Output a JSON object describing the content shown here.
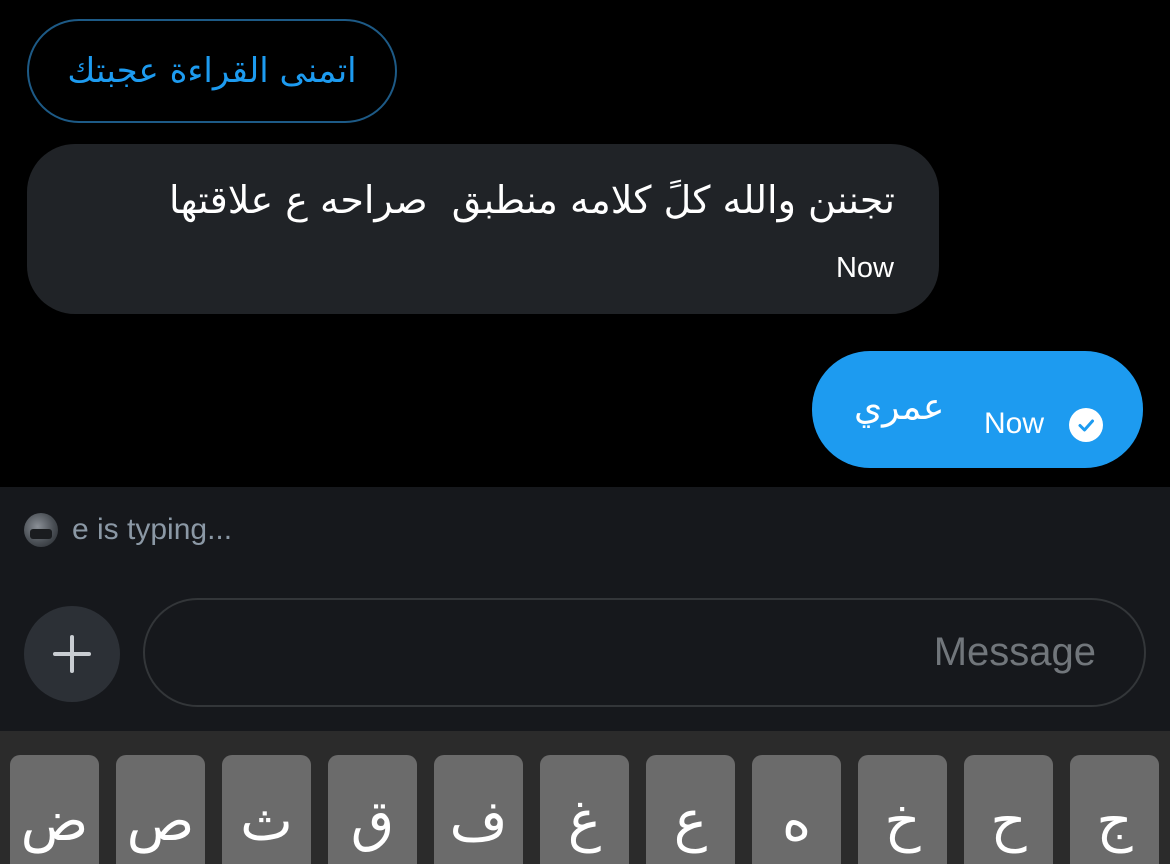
{
  "suggestion": {
    "text": "اتمنى القراءة عجبتك"
  },
  "received_message": {
    "text": "تجننن والله كلً كلامه منطبق  صراحه ع علاقتها",
    "time": "Now"
  },
  "sent_message": {
    "text": "عمري",
    "time": "Now",
    "status_icon": "check-circle-icon"
  },
  "typing_indicator": {
    "text": "e is typing..."
  },
  "composer": {
    "placeholder": "Message",
    "add_icon": "plus-icon"
  },
  "keyboard": {
    "keys": [
      "ض",
      "ص",
      "ث",
      "ق",
      "ف",
      "غ",
      "ع",
      "ه",
      "خ",
      "ح",
      "ج"
    ]
  },
  "colors": {
    "accent": "#1d9bf0",
    "background": "#000000",
    "bubble_received": "#202327",
    "composer_bg": "#16181c",
    "keyboard_bg": "#2b2b2b",
    "key_bg": "#6b6b6b"
  }
}
